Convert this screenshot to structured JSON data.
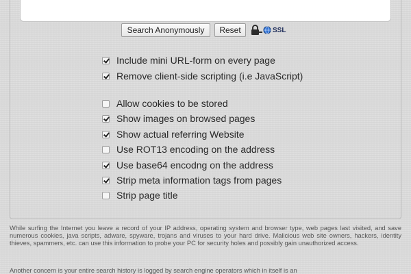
{
  "form": {
    "url_value": "",
    "search_button": "Search Anonymously",
    "reset_button": "Reset",
    "ssl_label": "SSL"
  },
  "options": [
    {
      "label": "Include mini URL-form on every page",
      "checked": true
    },
    {
      "label": "Remove client-side scripting (i.e JavaScript)",
      "checked": true
    },
    {
      "label": "Allow cookies to be stored",
      "checked": false
    },
    {
      "label": "Show images on browsed pages",
      "checked": true
    },
    {
      "label": "Show actual referring Website",
      "checked": true
    },
    {
      "label": "Use ROT13 encoding on the address",
      "checked": false
    },
    {
      "label": "Use base64 encodng on the address",
      "checked": true
    },
    {
      "label": "Strip meta information tags from pages",
      "checked": true
    },
    {
      "label": "Strip page title",
      "checked": false
    }
  ],
  "info": {
    "paragraph1": "While surfing the Internet you leave a record of your IP address, operating system and browser type, web pages last visited, and save numerous cookies, java scripts, adware, spyware, trojans and viruses to your hard drive. Malicious web site owners, hackers, identity thieves, spammers, etc. can use this information to probe your PC for security holes and possibly gain unauthorized access.",
    "paragraph2": "Another concern is your entire search history is logged by search engine operators which in itself is an"
  },
  "colors": {
    "background": "#dcdcdc",
    "ssl_text": "#1f2d5a",
    "globe": "#2c6fd1"
  }
}
